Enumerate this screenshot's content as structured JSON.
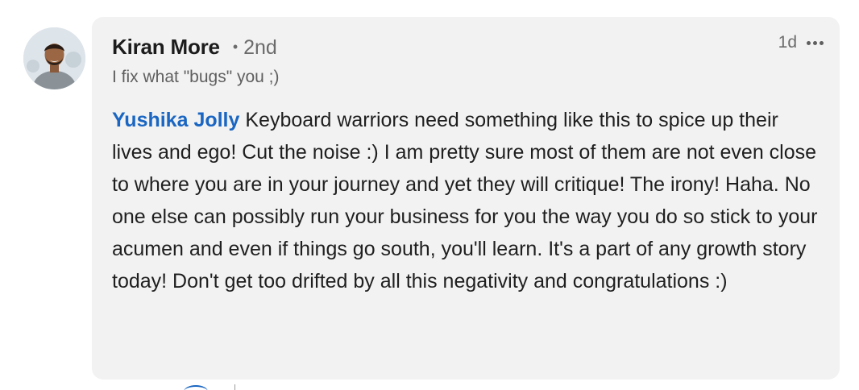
{
  "comment": {
    "author": {
      "name": "Kiran More",
      "degree": "2nd",
      "headline": "I fix what \"bugs\" you ;)",
      "avatar_icon": "profile-photo"
    },
    "timestamp": "1d",
    "menu_icon": "ellipsis-icon",
    "mention": "Yushika Jolly",
    "text": " Keyboard warriors need something like this to spice up their lives and ego! Cut the noise :) I am pretty sure most of them are not even close to where you are in your journey and yet they will critique! The irony! Haha. No one else can possibly run your business for you the way you do so stick to your acumen and even if things go south, you'll learn. It's a part of any growth story today! Don't get too drifted by all this negativity and congratulations :)"
  },
  "colors": {
    "accent": "#1a66c2",
    "bubble": "#f2f2f2",
    "muted": "#6b6b6b"
  }
}
